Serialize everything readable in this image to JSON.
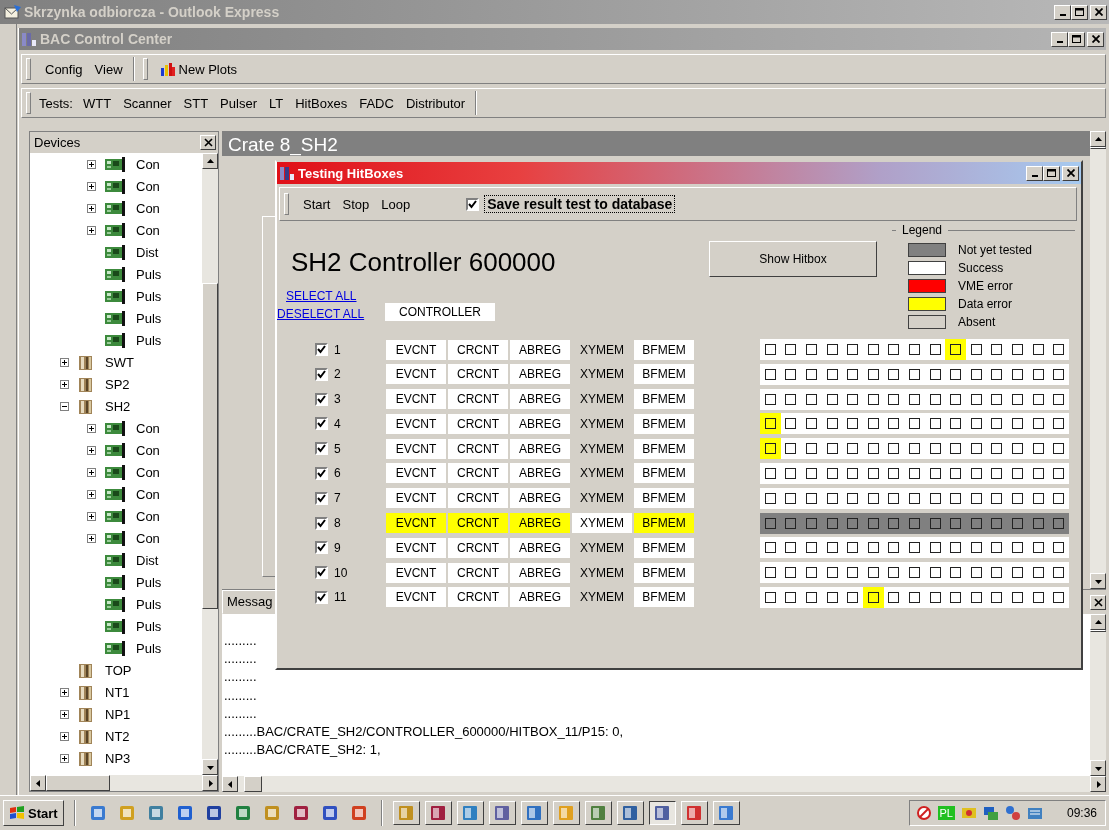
{
  "outer_window": {
    "title": "Skrzynka odbiorcza - Outlook Express"
  },
  "app_window": {
    "title": "BAC Control Center"
  },
  "menu": [
    "Config",
    "View"
  ],
  "toolbar": {
    "new_plots": "New Plots"
  },
  "tests_bar": {
    "label": "Tests:",
    "items": [
      "WTT",
      "Scanner",
      "STT",
      "Pulser",
      "LT",
      "HitBoxes",
      "FADC",
      "Distributor"
    ]
  },
  "devices_panel": {
    "title": "Devices",
    "tree": [
      {
        "children": [
          {
            "label": "Con",
            "kind": "board",
            "expanded": false
          },
          {
            "label": "Con",
            "kind": "board",
            "expanded": false
          },
          {
            "label": "Con",
            "kind": "board",
            "expanded": false
          },
          {
            "label": "Con",
            "kind": "board",
            "expanded": false
          },
          {
            "label": "Dist",
            "kind": "board"
          },
          {
            "label": "Puls",
            "kind": "board"
          },
          {
            "label": "Puls",
            "kind": "board"
          },
          {
            "label": "Puls",
            "kind": "board"
          },
          {
            "label": "Puls",
            "kind": "board"
          }
        ]
      },
      {
        "label": "SWT",
        "kind": "crate",
        "expanded": false
      },
      {
        "label": "SP2",
        "kind": "crate",
        "expanded": false
      },
      {
        "label": "SH2",
        "kind": "crate",
        "expanded": true,
        "children": [
          {
            "label": "Con",
            "kind": "board",
            "expanded": false
          },
          {
            "label": "Con",
            "kind": "board",
            "expanded": false
          },
          {
            "label": "Con",
            "kind": "board",
            "expanded": false
          },
          {
            "label": "Con",
            "kind": "board",
            "expanded": false
          },
          {
            "label": "Con",
            "kind": "board",
            "expanded": false
          },
          {
            "label": "Con",
            "kind": "board",
            "expanded": false
          },
          {
            "label": "Dist",
            "kind": "board"
          },
          {
            "label": "Puls",
            "kind": "board"
          },
          {
            "label": "Puls",
            "kind": "board"
          },
          {
            "label": "Puls",
            "kind": "board"
          },
          {
            "label": "Puls",
            "kind": "board"
          }
        ]
      },
      {
        "label": "TOP",
        "kind": "crate"
      },
      {
        "label": "NT1",
        "kind": "crate",
        "expanded": false
      },
      {
        "label": "NP1",
        "kind": "crate",
        "expanded": false
      },
      {
        "label": "NT2",
        "kind": "crate",
        "expanded": false
      },
      {
        "label": "NP3",
        "kind": "crate",
        "expanded": false
      }
    ]
  },
  "crate_header": "Crate 8_SH2",
  "messages": {
    "title": "Messag",
    "lines": [
      ".........",
      ".........",
      ".........",
      ".........",
      ".........",
      ".........BAC/CRATE_SH2/CONTROLLER_600000/HITBOX_11/P15: 0,",
      ".........BAC/CRATE_SH2: 1,"
    ]
  },
  "dialog": {
    "title": "Testing HitBoxes",
    "menu": [
      "Start",
      "Stop",
      "Loop"
    ],
    "save_option": {
      "label": "Save result test to database",
      "checked": true
    },
    "heading": "SH2 Controller 600000",
    "show_button": "Show Hitbox",
    "select_all": "SELECT ALL",
    "deselect_all": "DESELECT ALL",
    "controller_label": "CONTROLLER",
    "legend": {
      "title": "Legend",
      "items": [
        {
          "label": "Not yet tested",
          "color": "#808080"
        },
        {
          "label": "Success",
          "color": "#ffffff"
        },
        {
          "label": "VME error",
          "color": "#ff0000"
        },
        {
          "label": "Data error",
          "color": "#ffff00"
        },
        {
          "label": "Absent",
          "color": "#d4d0c8"
        }
      ]
    },
    "rows": [
      {
        "number": "1",
        "checked": true,
        "tests": [
          {
            "label": "EVCNT",
            "color": "#ffffff"
          },
          {
            "label": "CRCNT",
            "color": "#ffffff"
          },
          {
            "label": "ABREG",
            "color": "#ffffff"
          },
          {
            "label": "XYMEM",
            "color": "#d4d0c8"
          },
          {
            "label": "BFMEM",
            "color": "#ffffff"
          }
        ],
        "hitboxes": [
          {
            "color": "#ffffff"
          },
          {
            "color": "#ffffff"
          },
          {
            "color": "#ffffff"
          },
          {
            "color": "#ffffff"
          },
          {
            "color": "#ffffff"
          },
          {
            "color": "#ffffff"
          },
          {
            "color": "#ffffff"
          },
          {
            "color": "#ffffff"
          },
          {
            "color": "#ffffff"
          },
          {
            "color": "#ffff00"
          },
          {
            "color": "#ffffff"
          },
          {
            "color": "#ffffff"
          },
          {
            "color": "#ffffff"
          },
          {
            "color": "#ffffff"
          },
          {
            "color": "#ffffff"
          }
        ]
      },
      {
        "number": "2",
        "checked": true,
        "tests": [
          {
            "label": "EVCNT",
            "color": "#ffffff"
          },
          {
            "label": "CRCNT",
            "color": "#ffffff"
          },
          {
            "label": "ABREG",
            "color": "#ffffff"
          },
          {
            "label": "XYMEM",
            "color": "#d4d0c8"
          },
          {
            "label": "BFMEM",
            "color": "#ffffff"
          }
        ],
        "hitboxes": [
          {
            "color": "#ffffff"
          },
          {
            "color": "#ffffff"
          },
          {
            "color": "#ffffff"
          },
          {
            "color": "#ffffff"
          },
          {
            "color": "#ffffff"
          },
          {
            "color": "#ffffff"
          },
          {
            "color": "#ffffff"
          },
          {
            "color": "#ffffff"
          },
          {
            "color": "#ffffff"
          },
          {
            "color": "#ffffff"
          },
          {
            "color": "#ffffff"
          },
          {
            "color": "#ffffff"
          },
          {
            "color": "#ffffff"
          },
          {
            "color": "#ffffff"
          },
          {
            "color": "#ffffff"
          }
        ]
      },
      {
        "number": "3",
        "checked": true,
        "tests": [
          {
            "label": "EVCNT",
            "color": "#ffffff"
          },
          {
            "label": "CRCNT",
            "color": "#ffffff"
          },
          {
            "label": "ABREG",
            "color": "#ffffff"
          },
          {
            "label": "XYMEM",
            "color": "#d4d0c8"
          },
          {
            "label": "BFMEM",
            "color": "#ffffff"
          }
        ],
        "hitboxes": [
          {
            "color": "#ffffff"
          },
          {
            "color": "#ffffff"
          },
          {
            "color": "#ffffff"
          },
          {
            "color": "#ffffff"
          },
          {
            "color": "#ffffff"
          },
          {
            "color": "#ffffff"
          },
          {
            "color": "#ffffff"
          },
          {
            "color": "#ffffff"
          },
          {
            "color": "#ffffff"
          },
          {
            "color": "#ffffff"
          },
          {
            "color": "#ffffff"
          },
          {
            "color": "#ffffff"
          },
          {
            "color": "#ffffff"
          },
          {
            "color": "#ffffff"
          },
          {
            "color": "#ffffff"
          }
        ]
      },
      {
        "number": "4",
        "checked": true,
        "tests": [
          {
            "label": "EVCNT",
            "color": "#ffffff"
          },
          {
            "label": "CRCNT",
            "color": "#ffffff"
          },
          {
            "label": "ABREG",
            "color": "#ffffff"
          },
          {
            "label": "XYMEM",
            "color": "#d4d0c8"
          },
          {
            "label": "BFMEM",
            "color": "#ffffff"
          }
        ],
        "hitboxes": [
          {
            "color": "#ffff00"
          },
          {
            "color": "#ffffff"
          },
          {
            "color": "#ffffff"
          },
          {
            "color": "#ffffff"
          },
          {
            "color": "#ffffff"
          },
          {
            "color": "#ffffff"
          },
          {
            "color": "#ffffff"
          },
          {
            "color": "#ffffff"
          },
          {
            "color": "#ffffff"
          },
          {
            "color": "#ffffff"
          },
          {
            "color": "#ffffff"
          },
          {
            "color": "#ffffff"
          },
          {
            "color": "#ffffff"
          },
          {
            "color": "#ffffff"
          },
          {
            "color": "#ffffff"
          }
        ]
      },
      {
        "number": "5",
        "checked": true,
        "tests": [
          {
            "label": "EVCNT",
            "color": "#ffffff"
          },
          {
            "label": "CRCNT",
            "color": "#ffffff"
          },
          {
            "label": "ABREG",
            "color": "#ffffff"
          },
          {
            "label": "XYMEM",
            "color": "#d4d0c8"
          },
          {
            "label": "BFMEM",
            "color": "#ffffff"
          }
        ],
        "hitboxes": [
          {
            "color": "#ffff00"
          },
          {
            "color": "#ffffff"
          },
          {
            "color": "#ffffff"
          },
          {
            "color": "#ffffff"
          },
          {
            "color": "#ffffff"
          },
          {
            "color": "#ffffff"
          },
          {
            "color": "#ffffff"
          },
          {
            "color": "#ffffff"
          },
          {
            "color": "#ffffff"
          },
          {
            "color": "#ffffff"
          },
          {
            "color": "#ffffff"
          },
          {
            "color": "#ffffff"
          },
          {
            "color": "#ffffff"
          },
          {
            "color": "#ffffff"
          },
          {
            "color": "#ffffff"
          }
        ]
      },
      {
        "number": "6",
        "checked": true,
        "tests": [
          {
            "label": "EVCNT",
            "color": "#ffffff"
          },
          {
            "label": "CRCNT",
            "color": "#ffffff"
          },
          {
            "label": "ABREG",
            "color": "#ffffff"
          },
          {
            "label": "XYMEM",
            "color": "#d4d0c8"
          },
          {
            "label": "BFMEM",
            "color": "#ffffff"
          }
        ],
        "hitboxes": [
          {
            "color": "#ffffff"
          },
          {
            "color": "#ffffff"
          },
          {
            "color": "#ffffff"
          },
          {
            "color": "#ffffff"
          },
          {
            "color": "#ffffff"
          },
          {
            "color": "#ffffff"
          },
          {
            "color": "#ffffff"
          },
          {
            "color": "#ffffff"
          },
          {
            "color": "#ffffff"
          },
          {
            "color": "#ffffff"
          },
          {
            "color": "#ffffff"
          },
          {
            "color": "#ffffff"
          },
          {
            "color": "#ffffff"
          },
          {
            "color": "#ffffff"
          },
          {
            "color": "#ffffff"
          }
        ]
      },
      {
        "number": "7",
        "checked": true,
        "tests": [
          {
            "label": "EVCNT",
            "color": "#ffffff"
          },
          {
            "label": "CRCNT",
            "color": "#ffffff"
          },
          {
            "label": "ABREG",
            "color": "#ffffff"
          },
          {
            "label": "XYMEM",
            "color": "#d4d0c8"
          },
          {
            "label": "BFMEM",
            "color": "#ffffff"
          }
        ],
        "hitboxes": [
          {
            "color": "#ffffff"
          },
          {
            "color": "#ffffff"
          },
          {
            "color": "#ffffff"
          },
          {
            "color": "#ffffff"
          },
          {
            "color": "#ffffff"
          },
          {
            "color": "#ffffff"
          },
          {
            "color": "#ffffff"
          },
          {
            "color": "#ffffff"
          },
          {
            "color": "#ffffff"
          },
          {
            "color": "#ffffff"
          },
          {
            "color": "#ffffff"
          },
          {
            "color": "#ffffff"
          },
          {
            "color": "#ffffff"
          },
          {
            "color": "#ffffff"
          },
          {
            "color": "#ffffff"
          }
        ]
      },
      {
        "number": "8",
        "checked": true,
        "tests": [
          {
            "label": "EVCNT",
            "color": "#ffff00"
          },
          {
            "label": "CRCNT",
            "color": "#ffff00"
          },
          {
            "label": "ABREG",
            "color": "#ffff00"
          },
          {
            "label": "XYMEM",
            "color": "#ffffff"
          },
          {
            "label": "BFMEM",
            "color": "#ffff00"
          }
        ],
        "hitboxes": [
          {
            "color": "#808080"
          },
          {
            "color": "#808080"
          },
          {
            "color": "#808080"
          },
          {
            "color": "#808080"
          },
          {
            "color": "#808080"
          },
          {
            "color": "#808080"
          },
          {
            "color": "#808080"
          },
          {
            "color": "#808080"
          },
          {
            "color": "#808080"
          },
          {
            "color": "#808080"
          },
          {
            "color": "#808080"
          },
          {
            "color": "#808080"
          },
          {
            "color": "#808080"
          },
          {
            "color": "#808080"
          },
          {
            "color": "#808080"
          }
        ]
      },
      {
        "number": "9",
        "checked": true,
        "tests": [
          {
            "label": "EVCNT",
            "color": "#ffffff"
          },
          {
            "label": "CRCNT",
            "color": "#ffffff"
          },
          {
            "label": "ABREG",
            "color": "#ffffff"
          },
          {
            "label": "XYMEM",
            "color": "#d4d0c8"
          },
          {
            "label": "BFMEM",
            "color": "#ffffff"
          }
        ],
        "hitboxes": [
          {
            "color": "#ffffff"
          },
          {
            "color": "#ffffff"
          },
          {
            "color": "#ffffff"
          },
          {
            "color": "#ffffff"
          },
          {
            "color": "#ffffff"
          },
          {
            "color": "#ffffff"
          },
          {
            "color": "#ffffff"
          },
          {
            "color": "#ffffff"
          },
          {
            "color": "#ffffff"
          },
          {
            "color": "#ffffff"
          },
          {
            "color": "#ffffff"
          },
          {
            "color": "#ffffff"
          },
          {
            "color": "#ffffff"
          },
          {
            "color": "#ffffff"
          },
          {
            "color": "#ffffff"
          }
        ]
      },
      {
        "number": "10",
        "checked": true,
        "tests": [
          {
            "label": "EVCNT",
            "color": "#ffffff"
          },
          {
            "label": "CRCNT",
            "color": "#ffffff"
          },
          {
            "label": "ABREG",
            "color": "#ffffff"
          },
          {
            "label": "XYMEM",
            "color": "#d4d0c8"
          },
          {
            "label": "BFMEM",
            "color": "#ffffff"
          }
        ],
        "hitboxes": [
          {
            "color": "#ffffff"
          },
          {
            "color": "#ffffff"
          },
          {
            "color": "#ffffff"
          },
          {
            "color": "#ffffff"
          },
          {
            "color": "#ffffff"
          },
          {
            "color": "#ffffff"
          },
          {
            "color": "#ffffff"
          },
          {
            "color": "#ffffff"
          },
          {
            "color": "#ffffff"
          },
          {
            "color": "#ffffff"
          },
          {
            "color": "#ffffff"
          },
          {
            "color": "#ffffff"
          },
          {
            "color": "#ffffff"
          },
          {
            "color": "#ffffff"
          },
          {
            "color": "#ffffff"
          }
        ]
      },
      {
        "number": "11",
        "checked": true,
        "tests": [
          {
            "label": "EVCNT",
            "color": "#ffffff"
          },
          {
            "label": "CRCNT",
            "color": "#ffffff"
          },
          {
            "label": "ABREG",
            "color": "#ffffff"
          },
          {
            "label": "XYMEM",
            "color": "#d4d0c8"
          },
          {
            "label": "BFMEM",
            "color": "#ffffff"
          }
        ],
        "hitboxes": [
          {
            "color": "#ffffff"
          },
          {
            "color": "#ffffff"
          },
          {
            "color": "#ffffff"
          },
          {
            "color": "#ffffff"
          },
          {
            "color": "#ffffff"
          },
          {
            "color": "#ffff00"
          },
          {
            "color": "#ffffff"
          },
          {
            "color": "#ffffff"
          },
          {
            "color": "#ffffff"
          },
          {
            "color": "#ffffff"
          },
          {
            "color": "#ffffff"
          },
          {
            "color": "#ffffff"
          },
          {
            "color": "#ffffff"
          },
          {
            "color": "#ffffff"
          },
          {
            "color": "#ffffff"
          }
        ]
      }
    ]
  },
  "taskbar": {
    "start": "Start",
    "tray_language": "PL",
    "clock": "09:36"
  }
}
